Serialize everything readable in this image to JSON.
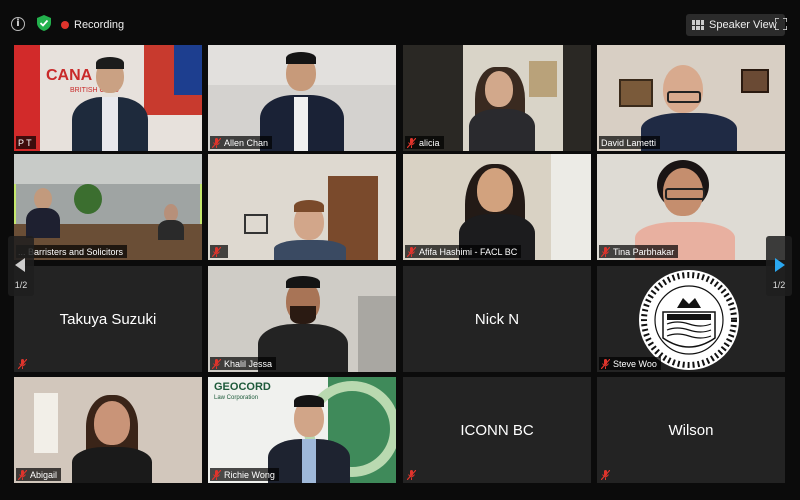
{
  "topbar": {
    "recording_label": "Recording",
    "speaker_view_label": "Speaker View"
  },
  "nav": {
    "left_count": "1/2",
    "right_count": "1/2"
  },
  "logos": {
    "geocord_name": "GEOCORD",
    "geocord_sub": "Law Corporation"
  },
  "tiles": [
    {
      "name": "P T"
    },
    {
      "name": "Allen Chan"
    },
    {
      "name": "alicia"
    },
    {
      "name": "David Lametti"
    },
    {
      "name": "... Barristers and Solicitors"
    },
    {
      "name": ""
    },
    {
      "name": "Afifa Hashimi - FACL BC"
    },
    {
      "name": "Tina Parbhakar"
    },
    {
      "name": "Takuya Suzuki"
    },
    {
      "name": "Khalil Jessa"
    },
    {
      "name": "Nick N"
    },
    {
      "name": "Steve Woo"
    },
    {
      "name": "Abigail"
    },
    {
      "name": "Richie Wong"
    },
    {
      "name": "ICONN BC"
    },
    {
      "name": "Wilson"
    }
  ]
}
